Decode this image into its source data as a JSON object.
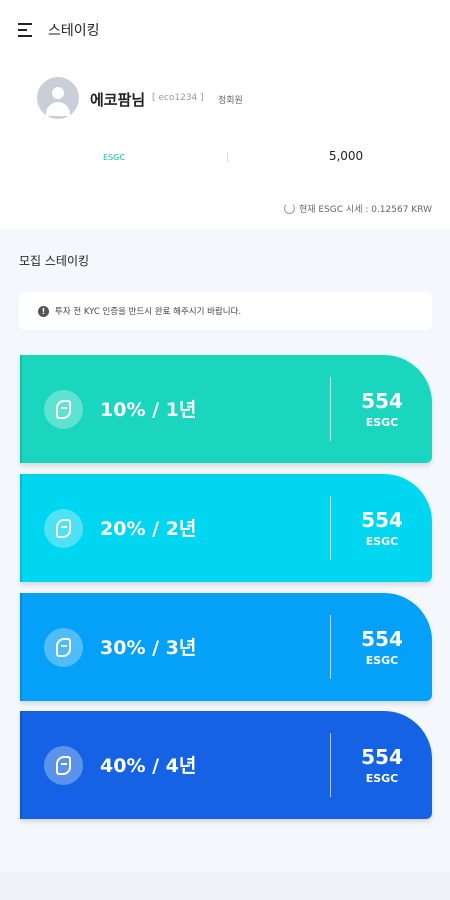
{
  "header": {
    "title": "스테이킹",
    "menu_icon": "hamburger-menu-icon"
  },
  "profile": {
    "name": "에코팜님",
    "user_id": "[ eco1234 ]",
    "grade": "정회원",
    "balance_label": "ESGC",
    "balance_value": "5,000",
    "rate_text": "현재 ESGC 시세 : 0.12567 KRW"
  },
  "main": {
    "section_title": "모집 스테이킹",
    "notice": "투자 전 KYC 인증을 반드시 완료 해주시기 바랍니다."
  },
  "cards": [
    {
      "plan": "10% / 1년",
      "amount": "554",
      "unit": "ESGC",
      "color": "#1ad6bf"
    },
    {
      "plan": "20% / 2년",
      "amount": "554",
      "unit": "ESGC",
      "color": "#00d6ef"
    },
    {
      "plan": "30% / 3년",
      "amount": "554",
      "unit": "ESGC",
      "color": "#05a1f8"
    },
    {
      "plan": "40% / 4년",
      "amount": "554",
      "unit": "ESGC",
      "color": "#1563e4"
    }
  ],
  "colors": {
    "accent": "#17c3b2",
    "background": "#f4f7fb"
  }
}
